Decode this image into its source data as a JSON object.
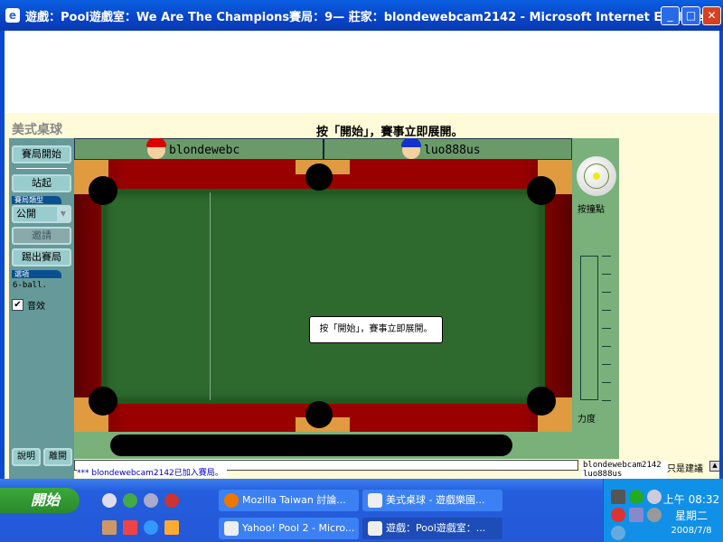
{
  "window": {
    "title": "遊戲：Pool遊戲室：We Are The Champions賽局：9— 莊家：blondewebcam2142 - Microsoft Internet Explorer",
    "min": "_",
    "max": "□",
    "close": "✕"
  },
  "game": {
    "title": "美式桌球",
    "top_message": "按「開始」，賽事立即展開。",
    "dialog": "按「開始」，賽事立即展開。",
    "left": {
      "start": "賽局開始",
      "stand": "站起",
      "type_label": "賽局類型",
      "type_value": "公開",
      "invite": "邀請",
      "kick": "踢出賽局",
      "options_label": "選項",
      "option_value": "6-ball.",
      "sound": "音效",
      "help": "說明",
      "leave": "離開"
    },
    "players": [
      "blondewebc",
      "luo888us"
    ],
    "right": {
      "aim": "按撞點",
      "power": "力度"
    },
    "chat": {
      "line": "*** blondewebcam2142已加入賽局。",
      "users": [
        "blondewebcam2142",
        "luo888us"
      ],
      "suggest": "只是建議"
    }
  },
  "taskbar": {
    "start": "開始",
    "tasks": [
      "Mozilla Taiwan 討論...",
      "美式桌球 - 遊戲樂園...",
      "Yahoo! Pool 2 - Micro...",
      "遊戲：Pool遊戲室：..."
    ],
    "time": "上午 08:32",
    "day": "星期二",
    "date": "2008/7/8"
  }
}
